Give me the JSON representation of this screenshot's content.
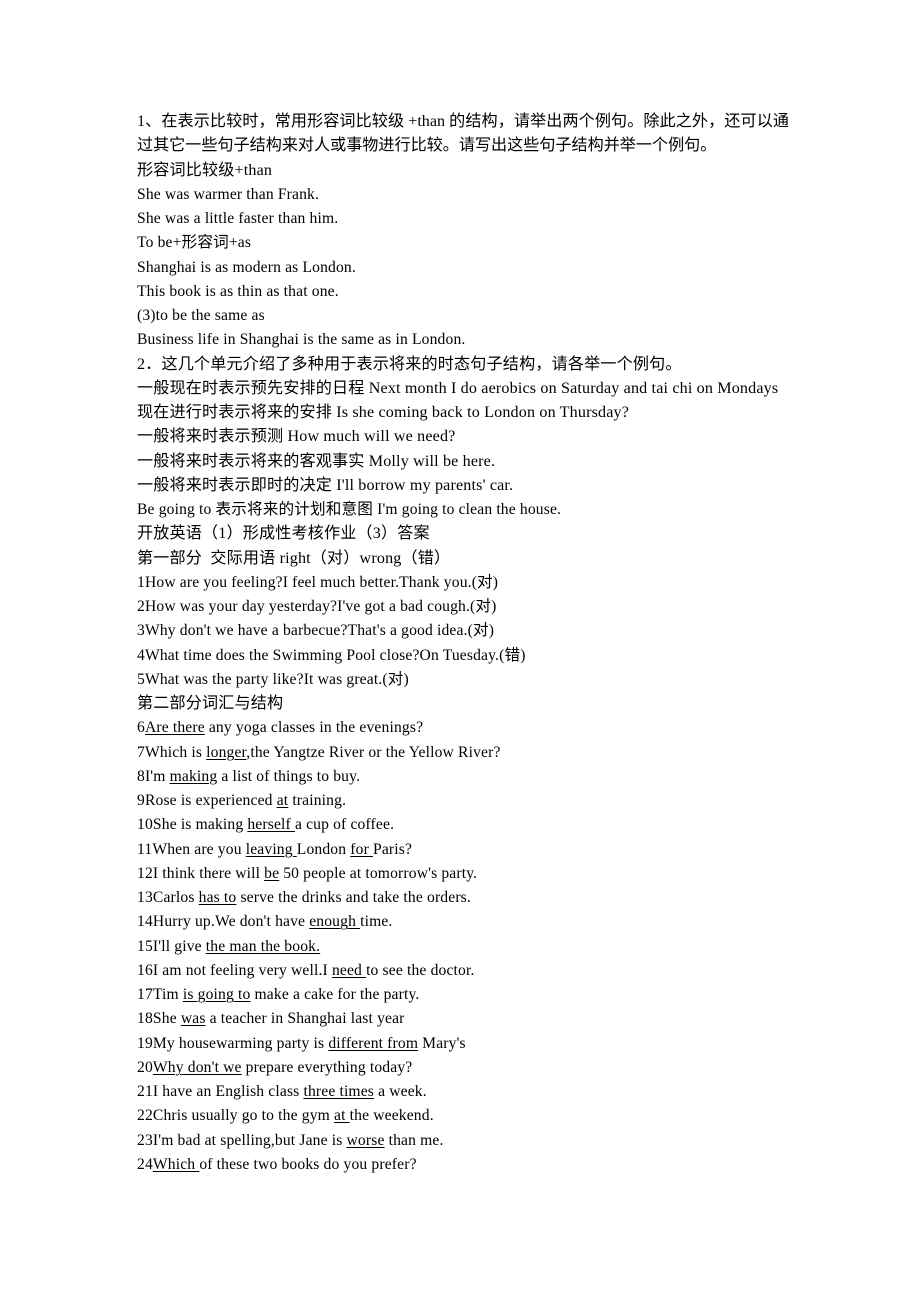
{
  "document": {
    "title": "开放英语（1）形成性考核作业（3）答案",
    "background_color": "#ffffff",
    "text_color": "#000000"
  },
  "section_grammar": {
    "question_1": "1、在表示比较时，常用形容词比较级 +than 的结构，请举出两个例句。除此之外，还可以通过其它一些句子结构来对人或事物进行比较。请写出这些句子结构并举一个例句。",
    "answers": [
      "形容词比较级+than",
      "She was warmer than Frank.",
      "She was a little faster than him.",
      "To be+形容词+as",
      "Shanghai is as modern as London.",
      "This book is as thin as that one.",
      "(3)to be the same as",
      "Business life in Shanghai is the same as in London."
    ],
    "question_2": "2．这几个单元介绍了多种用于表示将来的时态句子结构，请各举一个例句。",
    "answers_2": [
      "一般现在时表示预先安排的日程 Next month I do aerobics on Saturday and tai chi on Mondays",
      "现在进行时表示将来的安排 Is she coming back to London on Thursday?",
      "一般将来时表示预测 How much will we need?",
      "一般将来时表示将来的客观事实 Molly will be here.",
      "一般将来时表示即时的决定 I'll borrow my parents' car.",
      "Be going to 表示将来的计划和意图 I'm going to clean the house."
    ]
  },
  "assignment": {
    "heading": "开放英语（1）形成性考核作业（3）答案",
    "part_one": {
      "heading": "第一部分  交际用语 right（对）wrong（错）",
      "items": [
        "1How are you feeling?I feel much better.Thank you.(对)",
        "2How was your day yesterday?I've got a bad cough.(对)",
        "3Why don't we have a barbecue?That's a good idea.(对)",
        "4What time does the Swimming Pool close?On Tuesday.(错)",
        "5What was the party like?It was great.(对)"
      ]
    },
    "part_two": {
      "heading": "第二部分词汇与结构",
      "items": [
        {
          "num": "6",
          "before": "",
          "answer": "Are there",
          "after": " any yoga classes in the evenings?"
        },
        {
          "num": "7",
          "before": "Which is ",
          "answer": "longer",
          "after": ",the Yangtze River or the Yellow River?"
        },
        {
          "num": "8",
          "before": "I'm ",
          "answer": "making",
          "after": " a list of things to buy."
        },
        {
          "num": "9",
          "before": "Rose is experienced ",
          "answer": "at",
          "after": " training."
        },
        {
          "num": "10",
          "before": "She is making ",
          "answer": "herself ",
          "after": "a cup of coffee."
        },
        {
          "num": "11",
          "before": "When are you ",
          "answer": "leaving ",
          "after": "London ",
          "answer2": "for ",
          "after2": "Paris?"
        },
        {
          "num": "12",
          "before": "I think there will ",
          "answer": "be",
          "after": " 50 people at tomorrow's party."
        },
        {
          "num": "13",
          "before": "Carlos ",
          "answer": "has to",
          "after": " serve the drinks and take the orders."
        },
        {
          "num": "14",
          "before": "Hurry up.We don't have ",
          "answer": "enough ",
          "after": "time."
        },
        {
          "num": "15",
          "before": "I'll give ",
          "answer": "the man the book.",
          "after": ""
        },
        {
          "num": "16",
          "before": "I am not feeling very well.I ",
          "answer": "need ",
          "after": "to see the doctor."
        },
        {
          "num": "17",
          "before": "Tim ",
          "answer": "is going to",
          "after": " make a cake for the party."
        },
        {
          "num": "18",
          "before": "She ",
          "answer": "was",
          "after": " a teacher in Shanghai last year"
        },
        {
          "num": "19",
          "before": "My housewarming party is ",
          "answer": "different from",
          "after": " Mary's"
        },
        {
          "num": "20",
          "before": "",
          "answer": "Why don't we",
          "after": " prepare everything today?"
        },
        {
          "num": "21",
          "before": "I have an English class ",
          "answer": "three times",
          "after": " a week."
        },
        {
          "num": "22",
          "before": "Chris usually go to the gym ",
          "answer": "at ",
          "after": "the weekend."
        },
        {
          "num": "23",
          "before": "I'm bad at spelling,but Jane is ",
          "answer": "worse",
          "after": " than me."
        },
        {
          "num": "24",
          "before": "",
          "answer": "Which ",
          "after": "of these two books do you prefer?"
        }
      ]
    }
  }
}
